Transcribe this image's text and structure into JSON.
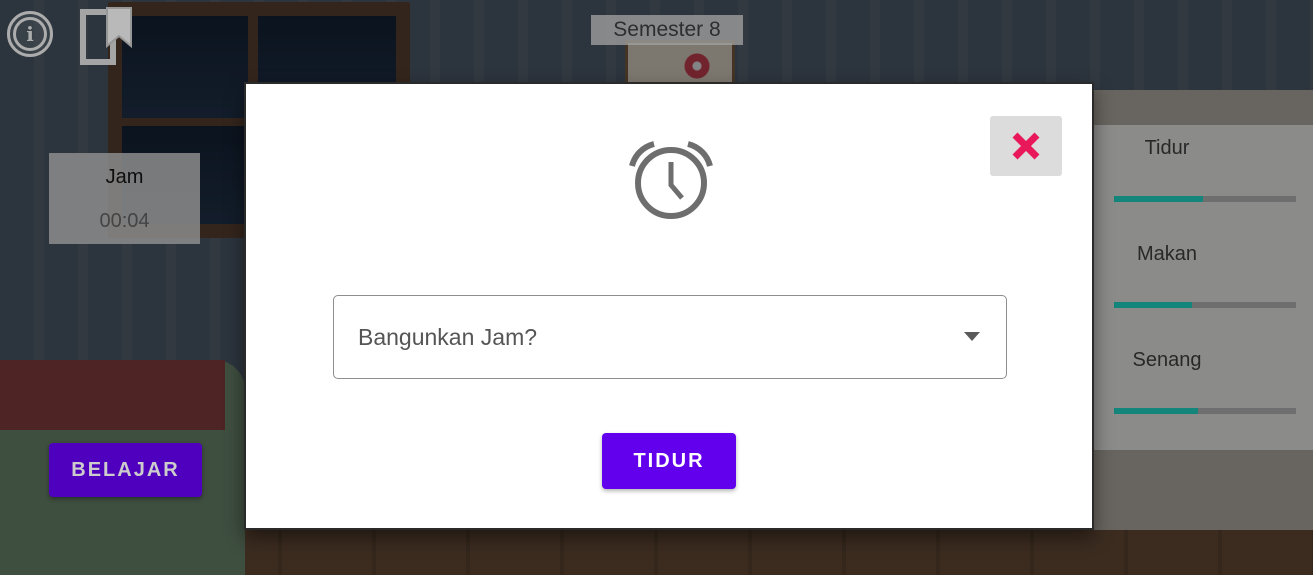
{
  "hud": {
    "info_icon": "info-icon",
    "bookmark_icon": "bookmark-icon",
    "semester_label": "Semester 8",
    "clock": {
      "label": "Jam",
      "time": "00:04"
    },
    "stats": [
      {
        "name": "Tidur",
        "level_percent": 49
      },
      {
        "name": "Makan",
        "level_percent": 43
      },
      {
        "name": "Senang",
        "level_percent": 46
      }
    ],
    "belajar_button": "BELAJAR"
  },
  "dialog": {
    "icon": "alarm-clock-icon",
    "close_icon": "close-icon",
    "select": {
      "value": "Bangunkan Jam?",
      "arrow_icon": "dropdown-arrow-icon"
    },
    "confirm_button": "TIDUR"
  },
  "colors": {
    "primary_button": "#6200ee",
    "close_icon": "#e8185a",
    "stat_fill": "#1aa79a",
    "stat_track": "#8a8a8a"
  }
}
